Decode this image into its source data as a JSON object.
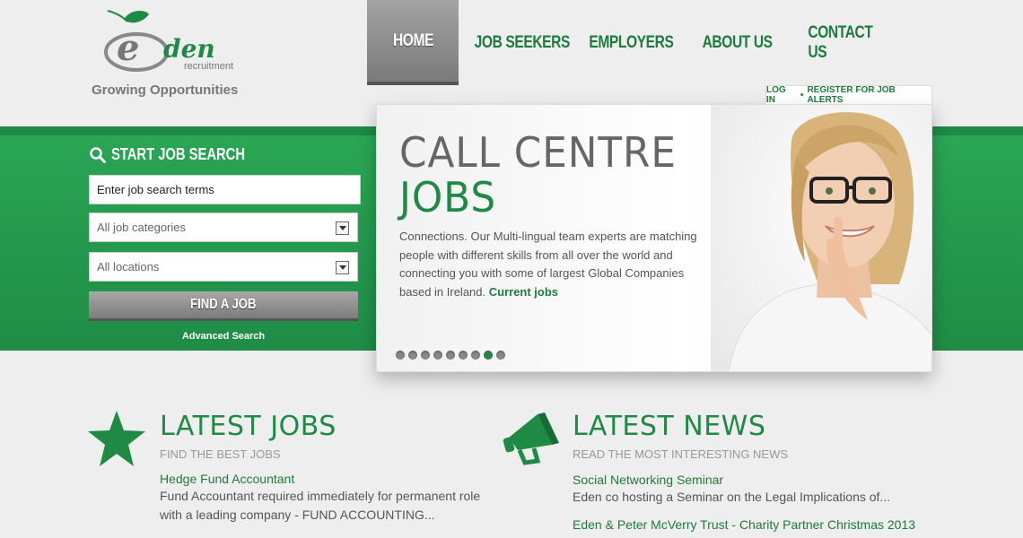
{
  "logo": {
    "brand_e": "e",
    "brand_den": "den",
    "sub": "recruitment",
    "tagline": "Growing Opportunities"
  },
  "nav": {
    "items": [
      {
        "label": "HOME",
        "active": true
      },
      {
        "label": "JOB SEEKERS"
      },
      {
        "label": "EMPLOYERS"
      },
      {
        "label": "ABOUT US"
      },
      {
        "label": "CONTACT US"
      }
    ]
  },
  "account": {
    "login": "LOG IN",
    "separator": "•",
    "register": "REGISTER FOR JOB ALERTS"
  },
  "search": {
    "title": "START JOB SEARCH",
    "terms_value": "Enter job search terms",
    "category_selected": "All job categories",
    "location_selected": "All locations",
    "find_button": "FIND A JOB",
    "advanced": "Advanced Search"
  },
  "slider": {
    "title_line1": "CALL CENTRE",
    "title_line2": "JOBS",
    "body": "Connections. Our Multi-lingual team experts are matching people with different skills from all over the world and connecting you with some of largest Global Companies based in Ireland.",
    "link": "Current jobs",
    "dot_count": 9,
    "active_dot": 8
  },
  "latest_jobs": {
    "title": "LATEST JOBS",
    "subtitle": "FIND THE BEST JOBS",
    "items": [
      {
        "title": "Hedge Fund Accountant",
        "desc_line1": "Fund Accountant required immediately for permanent role",
        "desc_line2": "with a leading company - FUND ACCOUNTING..."
      }
    ]
  },
  "latest_news": {
    "title": "LATEST NEWS",
    "subtitle": "READ THE MOST INTERESTING NEWS",
    "items": [
      {
        "title": "Social Networking Seminar",
        "desc": "Eden co hosting a Seminar on the Legal Implications of..."
      },
      {
        "title": "Eden & Peter McVerry Trust - Charity Partner Christmas 2013"
      }
    ]
  },
  "colors": {
    "brand_green": "#1e8a45",
    "nav_active_gray": "#8a8a8a",
    "background": "#eeeeee"
  }
}
